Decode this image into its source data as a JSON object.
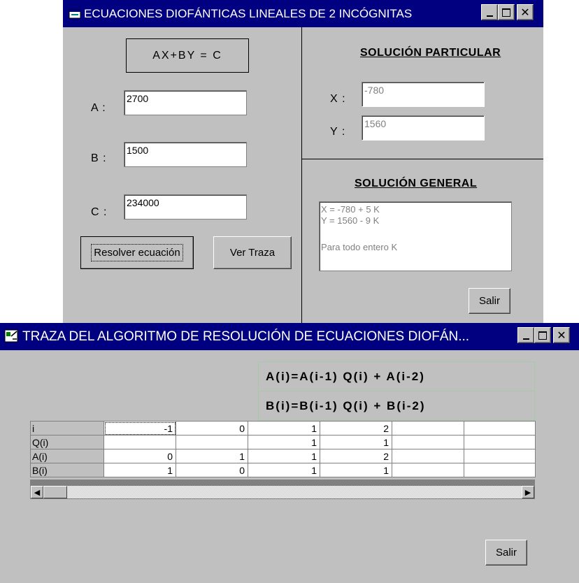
{
  "equations_window": {
    "title": "ECUACIONES DIOFÁNTICAS LINEALES DE 2 INCÓGNITAS",
    "minimize_icon": "minimize-icon",
    "maximize_icon": "maximize-icon",
    "close_icon": "close-icon",
    "equation_label": "AX+BY = C",
    "input_a": {
      "label": "A :",
      "value": "2700"
    },
    "input_b": {
      "label": "B :",
      "value": "1500"
    },
    "input_c": {
      "label": "C :",
      "value": "234000"
    },
    "solve_button": "Resolver ecuación",
    "trace_button": "Ver Traza",
    "particular": {
      "heading": "SOLUCIÓN PARTICULAR",
      "x_label": "X :",
      "x_value": "-780",
      "y_label": "Y :",
      "y_value": "1560"
    },
    "general": {
      "heading": "SOLUCIÓN GENERAL",
      "lines": [
        "X = -780 + 5 K",
        "Y = 1560 - 9 K",
        "",
        "Para todo entero K"
      ]
    },
    "exit_button": "Salir"
  },
  "trace_window": {
    "title": "TRAZA DEL ALGORITMO DE RESOLUCIÓN DE ECUACIONES DIOFÁN...",
    "formula_a": "A(i)=A(i-1) Q(i) + A(i-2)",
    "formula_b": "B(i)=B(i-1) Q(i) + B(i-2)",
    "table": {
      "rows": [
        {
          "header": "i",
          "cells": [
            "-1",
            "0",
            "1",
            "2",
            "",
            ""
          ]
        },
        {
          "header": "Q(i)",
          "cells": [
            "",
            "",
            "1",
            "1",
            "",
            ""
          ]
        },
        {
          "header": "A(i)",
          "cells": [
            "0",
            "1",
            "1",
            "2",
            "",
            ""
          ]
        },
        {
          "header": "B(i)",
          "cells": [
            "1",
            "0",
            "1",
            "1",
            "",
            ""
          ]
        }
      ]
    },
    "scroll_left_icon": "scroll-left-icon",
    "scroll_right_icon": "scroll-right-icon",
    "exit_button": "Salir"
  },
  "colors": {
    "titlebar": "#000080",
    "window_face": "#c0c0c0",
    "disabled_text": "#808080"
  }
}
